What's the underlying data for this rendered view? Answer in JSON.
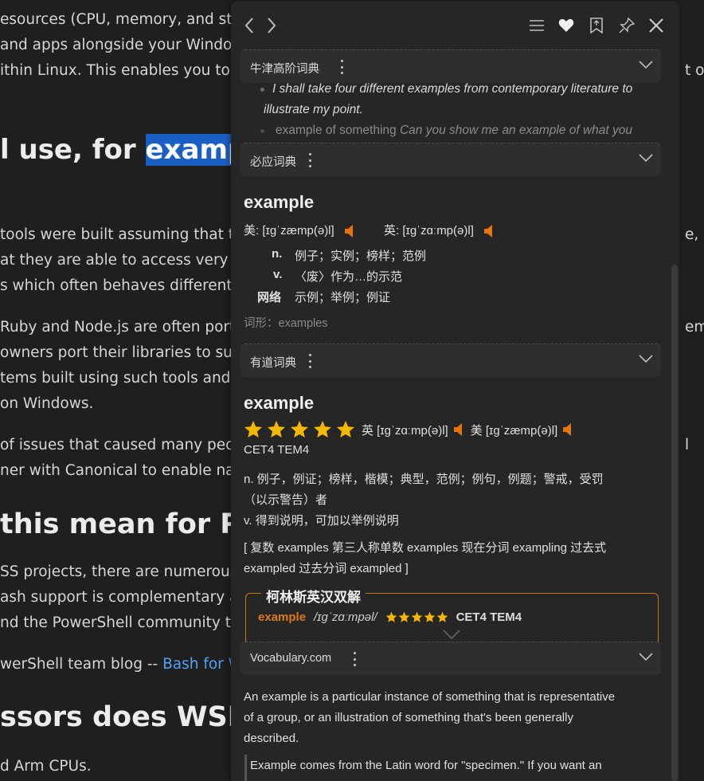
{
  "article": {
    "lines": [
      "esources (CPU, memory, and stora",
      "and apps alongside your Windows",
      "ithin Linux. This enables you to us",
      "tools were built assuming that th",
      "at they are able to access very lo",
      "s which often behaves differently",
      "Ruby and Node.js are often porte",
      "owners port their libraries to supp",
      "tems built using such tools and li",
      "on Windows.",
      "of issues that caused many people",
      "ner with Canonical to enable nati",
      "SS projects, there are numerous s",
      "ash support is complementary an",
      "nd the PowerShell community to",
      "d Arm CPUs."
    ],
    "heading1_pre": "l use, for ",
    "heading1_selected": "example",
    "heading1_post": ",",
    "heading2": "this mean for Powe",
    "heading3": "ssors does WSL sup",
    "blog_prefix": "werShell team blog -- ",
    "blog_link": "Bash for W",
    "right_frags": [
      "t of",
      "e,",
      "em",
      "l"
    ]
  },
  "toolbar": {
    "back_icon": "chevron-left-icon",
    "forward_icon": "chevron-right-icon",
    "menu_icon": "menu-icon",
    "favorite_icon": "heart-icon",
    "wordbook_icon": "bookmark-icon",
    "pin_icon": "pin-icon",
    "close_icon": "close-icon"
  },
  "oxford": {
    "name": "牛津高阶词典",
    "example1_line1": "I shall take four different examples from contemporary literature to",
    "example1_line2": "illustrate my point.",
    "example2_pre": "example of something ",
    "example2_italic": "Can you show me an example of what you"
  },
  "bing": {
    "name": "必应词典",
    "headword": "example",
    "us_label": "美: [ɪɡˈzæmp(ə)l]",
    "uk_label": "英: [ɪɡˈzɑːmp(ə)l]",
    "senses": [
      {
        "pos": "n.",
        "def": "例子；实例；榜样；范例"
      },
      {
        "pos": "v.",
        "def": "〈废〉作为…的示范"
      },
      {
        "pos": "网络",
        "def": "示例；举例；例证"
      }
    ],
    "forms": "词形：examples"
  },
  "youdao": {
    "name": "有道词典",
    "headword": "example",
    "stars": 5,
    "uk_label": "英 [ɪɡˈzɑːmp(ə)l]",
    "us_label": "美 [ɪɡˈzæmp(ə)l]",
    "exam_tags": "CET4 TEM4",
    "def_n_line1": "n. 例子，例证；榜样，楷模；典型，范例；例句，例题；警戒，受罚",
    "def_n_line2": "（以示警告）者",
    "def_v": "v. 得到说明，可加以举例说明",
    "wfs_line1": "[ 复数 examples 第三人称单数 examples 现在分词 exampling 过去式",
    "wfs_line2": "exampled 过去分词 exampled ]",
    "collins_title": "柯林斯英汉双解",
    "collins_word": "example",
    "collins_pron": "/ɪɡˈzɑːmpəl/",
    "collins_stars": 5,
    "collins_tags": "CET4 TEM4"
  },
  "vocabulary": {
    "name": "Vocabulary.com",
    "blurb_line1": "An example is a particular instance of something that is representative",
    "blurb_line2": "of a group, or an illustration of something that's been generally",
    "blurb_line3": "described.",
    "long_line1": "Example comes from the Latin word for \"specimen.\" If you want an"
  },
  "colors": {
    "accent_orange": "#e8740c",
    "star_gold": "#f5b800",
    "selection_blue": "#1c5fc4",
    "link_blue": "#4ea3f2"
  }
}
